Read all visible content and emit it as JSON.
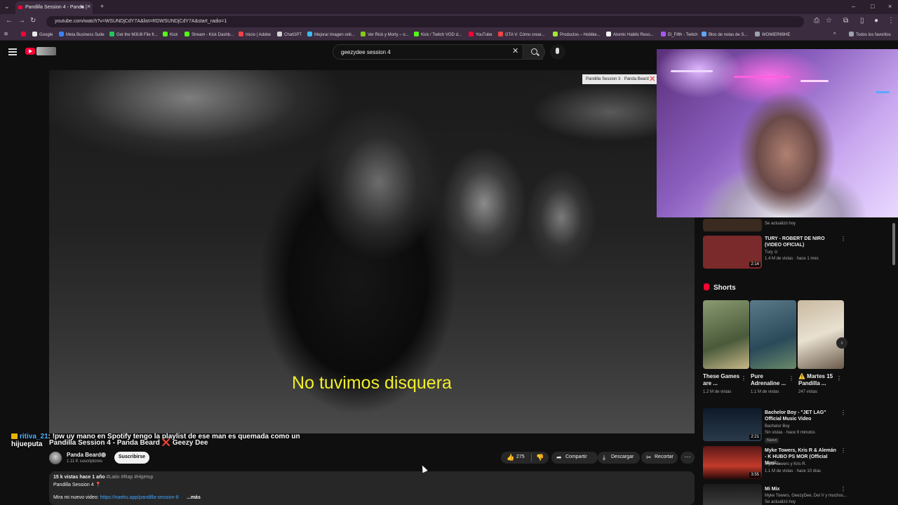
{
  "browser": {
    "tab_title": "Pandilla Session 4 - Panda |",
    "url": "youtube.com/watch?v=WSUNDjCdY7A&list=RDWSUNDjCdY7A&start_radio=1",
    "bookmarks": [
      {
        "label": "Google",
        "color": "#ffffff"
      },
      {
        "label": "Meta Business Suite",
        "color": "#3b82f6"
      },
      {
        "label": "Get the M3U8 File fr...",
        "color": "#22c55e"
      },
      {
        "label": "Kick",
        "color": "#53fc18"
      },
      {
        "label": "Stream - Kick Dashb...",
        "color": "#53fc18"
      },
      {
        "label": "Inicio | Adobe",
        "color": "#ef4444"
      },
      {
        "label": "ChatGPT",
        "color": "#d4d4d4"
      },
      {
        "label": "Mejorar imagen onli...",
        "color": "#38bdf8"
      },
      {
        "label": "Ver Rick y Morty – o...",
        "color": "#84cc16"
      },
      {
        "label": "Kick / Twitch VOD d...",
        "color": "#53fc18"
      },
      {
        "label": "YouTube",
        "color": "#ff0033"
      },
      {
        "label": "GTA V: Cómo crear...",
        "color": "#ef4444"
      },
      {
        "label": "Productos – Hobbie...",
        "color": "#a3e635"
      },
      {
        "label": "Atomic Habits Reso...",
        "color": "#f5f5f5"
      },
      {
        "label": "El_Fifth - Twitch",
        "color": "#a855f7"
      },
      {
        "label": "Bloc de notas de S...",
        "color": "#60a5fa"
      },
      {
        "label": "WOMIER69HE",
        "color": "#9ca3af"
      }
    ],
    "all_bookmarks": "Todos los favoritos"
  },
  "search": {
    "query": "geezydee session 4"
  },
  "player": {
    "subtitle": "No tuvimos disquera",
    "next_pill": "Pandilla Session 3 · Panda Beard ❌ Y"
  },
  "chat": {
    "user": "ritiva_21",
    "message": ": !pw uy mano en Spotify tengo la playlist de ese man es quemada como un hijueputa"
  },
  "video": {
    "title_prefix": "Pandilla Session 4 - Panda Beard",
    "title_x": "❌",
    "title_suffix": "Geezy Dee",
    "channel": "Panda Beard",
    "subscribers": "1.11 K suscriptores",
    "subscribe_label": "Suscribirse",
    "likes": "275",
    "share_label": "Compartir",
    "download_label": "Descargar",
    "clip_label": "Recortar",
    "views_date": "15 k vistas  hace 1 año",
    "tags": "#Latin #Rap #HipHop",
    "desc_line1": "Pandilla Session 4 📍",
    "desc_line2_prefix": "Mira mi nuevo video: ",
    "desc_link": "https://naeku.app/pandilla-session-8",
    "desc_more": "...más"
  },
  "sidebar": {
    "top_partial_meta": "Se actualizó hoy",
    "recs": [
      {
        "title": "TURY - ROBERT DE NIRO (VIDEO OFICIAL)",
        "channel": "Tury ⊙",
        "stats": "1.4 M de vistas · hace 1 mes",
        "duration": "2:14",
        "thumb": "#7a2a2a"
      },
      {
        "title": "Bachelor Boy - \"JET LAG\" Official Music Video",
        "channel": "Bachelor Boy",
        "stats": "Sin vistas · hace 9 minutos",
        "duration": "2:21",
        "badge": "Nuevo",
        "thumb": "#1a2a3a"
      },
      {
        "title": "Myke Towers, Kris R & Alemán - K HUBO PS MOR (Official Musi...",
        "channel": "Myke Towers y Kris R.",
        "stats": "1.1 M de vistas · hace 10 días",
        "duration": "3:55",
        "thumb": "#6a1f1f"
      },
      {
        "title": "Mi Mix",
        "channel": "Myke Towers, GeezyDee, Del V y muchos...",
        "stats": "Se actualizó hoy",
        "thumb": "#2b2b2b"
      }
    ],
    "shorts_label": "Shorts",
    "shorts": [
      {
        "title": "These Games are ...",
        "views": "1.2 M de vistas",
        "thumb": "#5d6b4a"
      },
      {
        "title": "Pure Adrenaline ...",
        "views": "1.1 M de vistas",
        "thumb": "#3d5a6a"
      },
      {
        "title": "⚠️ Martes 15 Pandilla ...",
        "views": "247 vistas",
        "thumb": "#a08a6a"
      }
    ]
  },
  "colors": {
    "accent": "#ff0033",
    "subtitle": "#f2ef2a",
    "link": "#3ea6ff"
  }
}
